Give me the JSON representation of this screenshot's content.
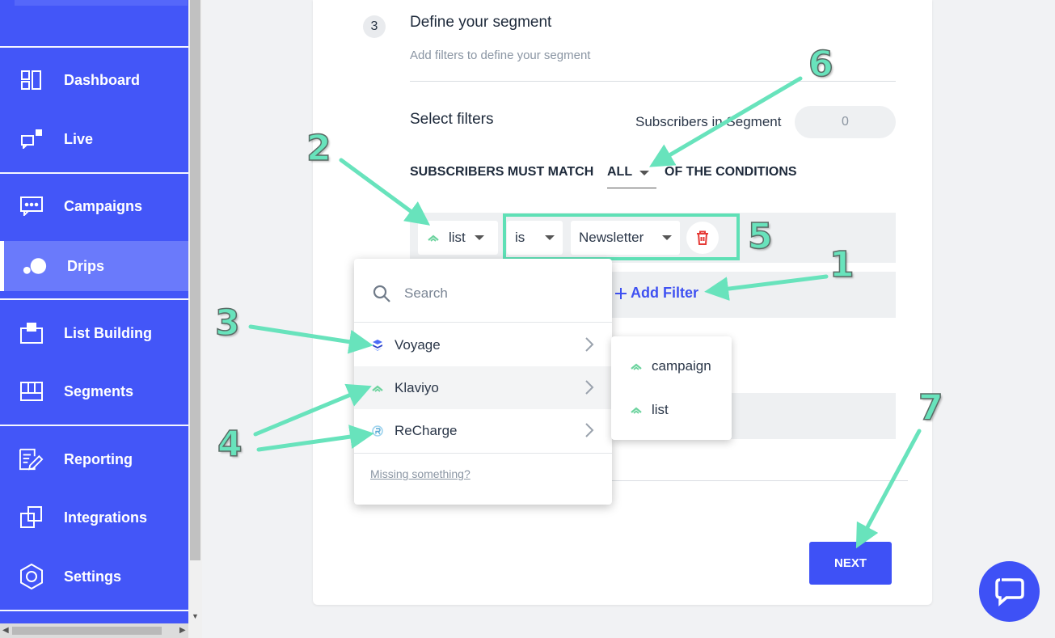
{
  "sidebar": {
    "items": [
      {
        "label": "Dashboard",
        "icon": "dashboard-icon"
      },
      {
        "label": "Live",
        "icon": "live-icon"
      },
      {
        "label": "Campaigns",
        "icon": "campaigns-icon"
      },
      {
        "label": "Drips",
        "icon": "drips-icon",
        "active": true
      },
      {
        "label": "List Building",
        "icon": "list-building-icon"
      },
      {
        "label": "Segments",
        "icon": "segments-icon"
      },
      {
        "label": "Reporting",
        "icon": "reporting-icon"
      },
      {
        "label": "Integrations",
        "icon": "integrations-icon"
      },
      {
        "label": "Settings",
        "icon": "settings-icon"
      }
    ]
  },
  "step": {
    "number": "3",
    "title": "Define your segment",
    "subtitle": "Add filters to define your segment"
  },
  "filters": {
    "heading": "Select filters",
    "subscribers_label": "Subscribers in Segment",
    "subscribers_count": "0",
    "match_prefix": "SUBSCRIBERS MUST MATCH",
    "match_value": "ALL",
    "match_suffix": "OF THE CONDITIONS",
    "condition": {
      "field": "list",
      "operator": "is",
      "value": "Newsletter"
    },
    "add_filter_label": "Add Filter"
  },
  "dropdown": {
    "search_placeholder": "Search",
    "items": [
      {
        "label": "Voyage",
        "icon": "voyage-icon"
      },
      {
        "label": "Klaviyo",
        "icon": "klaviyo-icon",
        "hovered": true
      },
      {
        "label": "ReCharge",
        "icon": "recharge-icon"
      }
    ],
    "missing_label": "Missing something?"
  },
  "submenu": {
    "items": [
      {
        "label": "campaign",
        "icon": "klaviyo-icon"
      },
      {
        "label": "list",
        "icon": "klaviyo-icon"
      }
    ]
  },
  "next_label": "NEXT",
  "annotations": [
    "1",
    "2",
    "3",
    "4",
    "5",
    "6",
    "7"
  ],
  "colors": {
    "sidebar": "#4356f8",
    "accent": "#3e51f6",
    "annotation": "#68e3bc",
    "delete": "#e53935"
  }
}
